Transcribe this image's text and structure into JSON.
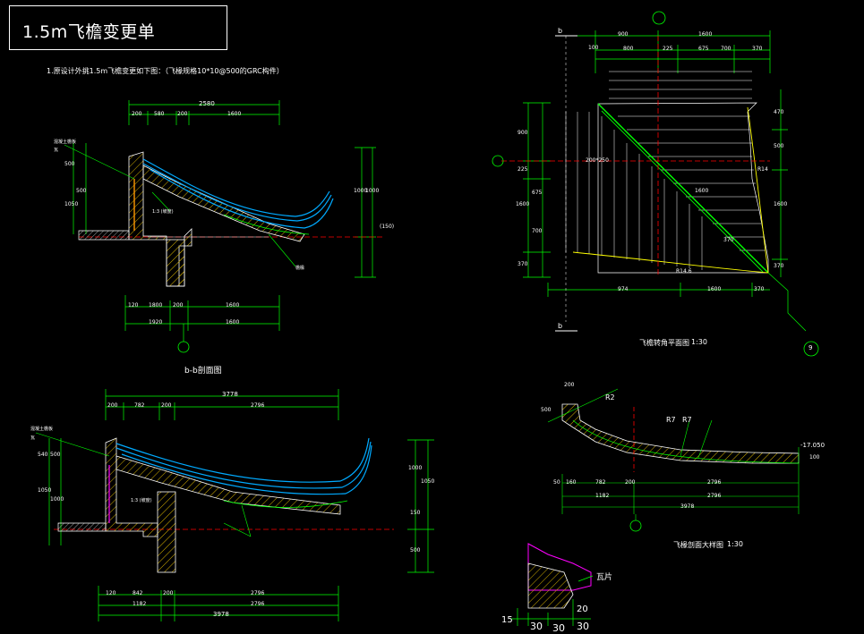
{
  "drawing": {
    "title": "1.5m飞檐变更单",
    "note": "1.原设计外挑1.5m飞檐变更如下图：（飞椽规格10*10@500的GRC构件）",
    "colors": {
      "background": "#000000",
      "dimension": "#00ff00",
      "text": "#ffffff",
      "eave_line": "#00aaff",
      "hatch": "#ffff00",
      "axis": "#ff0000",
      "cyan": "#00ffff",
      "magenta": "#ff00ff"
    }
  },
  "views": {
    "section_b": {
      "caption": "b-b剖面图",
      "dims_top": [
        "2580",
        "200",
        "580",
        "200",
        "1600"
      ],
      "dims_bottom": [
        "120",
        "1800",
        "200",
        "1600",
        "1920",
        "1600"
      ],
      "dims_left": [
        "500",
        "1050",
        "500"
      ],
      "dims_right": [
        "1000",
        "1000",
        "(150)"
      ],
      "labels": [
        "混凝土檐板",
        "瓦",
        "1:3 (坡度)",
        "檐椽"
      ]
    },
    "section_main": {
      "dims_top": [
        "3778",
        "200",
        "782",
        "200",
        "2796"
      ],
      "dims_bottom": [
        "120",
        "842",
        "200",
        "2796",
        "1182",
        "2796",
        "3978"
      ],
      "dims_left": [
        "540",
        "500",
        "1050",
        "1000"
      ],
      "dims_right": [
        "1000",
        "1050",
        "150",
        "500"
      ],
      "labels": [
        "混凝土檐板",
        "瓦",
        "1:3 (坡度)"
      ]
    },
    "plan": {
      "caption": "飞檐转角平面图",
      "scale": "1:30",
      "section_mark": "b",
      "axis_label": "9",
      "dims_top": [
        "900",
        "1600",
        "100",
        "800",
        "225",
        "675",
        "700",
        "370"
      ],
      "dims_left": [
        "900",
        "225",
        "675",
        "1600",
        "700",
        "370"
      ],
      "dims_right": [
        "470",
        "500",
        "1600",
        "370"
      ],
      "dims_bottom": [
        "974",
        "1600",
        "370"
      ],
      "labels": [
        "200*250",
        "R14",
        "R14.6",
        "1600",
        "370"
      ]
    },
    "detail": {
      "caption": "飞椽剖面大样图",
      "scale": "1:30",
      "radius_labels": [
        "R2",
        "R7",
        "R7"
      ],
      "dims_top": [
        "200",
        "500"
      ],
      "dims_bottom": [
        "50",
        "160",
        "782",
        "200",
        "2796",
        "1182",
        "2796",
        "3978"
      ],
      "elevation": "-17.050",
      "thickness": "100"
    },
    "eave_detail": {
      "label": "瓦片",
      "dims": [
        "15",
        "30",
        "30",
        "20",
        "30"
      ]
    }
  }
}
